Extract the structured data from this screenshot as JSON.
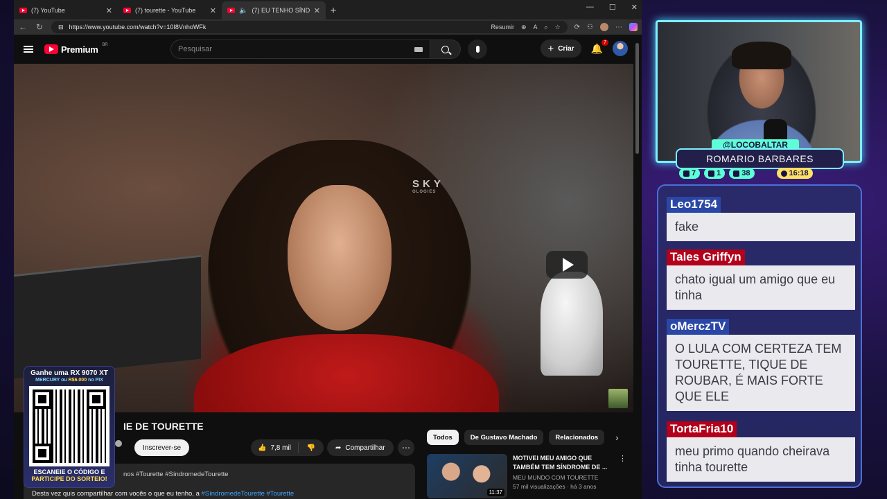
{
  "browser": {
    "tabs": [
      {
        "title": "(7) YouTube",
        "active": false
      },
      {
        "title": "(7) tourette - YouTube",
        "active": false
      },
      {
        "title": "(7) EU TENHO SÍNDROME DE",
        "active": true
      }
    ],
    "url": "https://www.youtube.com/watch?v=10I8VnhoWFk",
    "resumir_label": "Resumir"
  },
  "youtube": {
    "logo_text": "Premium",
    "logo_country": "BR",
    "search_placeholder": "Pesquisar",
    "create_label": "Criar",
    "notifications_count": "7",
    "video": {
      "title": "IE DE TOURETTE",
      "subscribe_label": "Inscrever-se",
      "likes": "7,8 mil",
      "share_label": "Compartilhar",
      "tags_prefix": "nos",
      "tags": "#Tourette #SíndromedeTourette",
      "description_text": "Desta vez quis compartilhar com vocês o que eu tenho, a ",
      "description_links": "#SíndromedeTourette #Tourette"
    },
    "chips": [
      "Todos",
      "De Gustavo Machado",
      "Relacionados"
    ],
    "recommended": [
      {
        "title": "MOTIVEI MEU AMIGO QUE TAMBÉM TEM SÍNDROME DE ...",
        "channel": "MEU MUNDO COM TOURETTE",
        "stats": "57 mil visualizações · há 3 anos",
        "duration": "11:37"
      }
    ],
    "chair_brand": "SKY",
    "chair_sub": "OLOGIES"
  },
  "qr_promo": {
    "line1": "Ganhe uma RX 9070 XT",
    "line2a": "MERCURY ou ",
    "line2b": "R$6.000",
    "line2c": " no PIX",
    "line3a": "ESCANEIE O CÓDIGO E",
    "line3b": "PARTICIPE DO SORTEIO!"
  },
  "streamer": {
    "handle": "@LOCOBALTAR",
    "name": "ROMARIO BARBARES",
    "stats": [
      {
        "icon": "chat-icon",
        "value": "7"
      },
      {
        "icon": "youtube-icon",
        "value": "1"
      },
      {
        "icon": "viewers-icon",
        "value": "38"
      }
    ],
    "uptime": "16:18"
  },
  "chat": [
    {
      "user": "Leo1754",
      "text": "fake",
      "color": "blue"
    },
    {
      "user": "Tales Griffyn",
      "text": "chato igual um amigo que eu tinha",
      "color": "red"
    },
    {
      "user": "oMerczTV",
      "text": "O LULA COM CERTEZA TEM TOURETTE, TIQUE DE ROUBAR, É MAIS FORTE QUE ELE",
      "color": "blue"
    },
    {
      "user": "TortaFria10",
      "text": "meu primo quando cheirava tinha tourette",
      "color": "red"
    }
  ],
  "colors": {
    "yt_red": "#ff0033",
    "accent_cyan": "#7cf0ff",
    "chat_red": "#b3001b",
    "chat_blue": "#2a47a8"
  }
}
